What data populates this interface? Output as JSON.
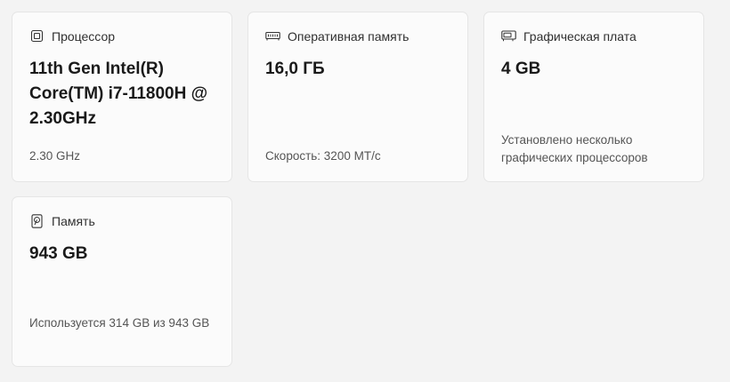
{
  "cards": [
    {
      "title": "Процессор",
      "icon": "cpu-icon",
      "value": "11th Gen Intel(R) Core(TM) i7-11800H @ 2.30GHz",
      "detail": "2.30 GHz"
    },
    {
      "title": "Оперативная память",
      "icon": "ram-icon",
      "value": "16,0 ГБ",
      "detail": "Скорость: 3200 МТ/с"
    },
    {
      "title": "Графическая плата",
      "icon": "gpu-icon",
      "value": "4 GB",
      "detail": "Установлено несколько графических процессоров"
    },
    {
      "title": "Память",
      "icon": "storage-icon",
      "value": "943 GB",
      "detail": "Используется 314 GB из 943 GB"
    }
  ]
}
